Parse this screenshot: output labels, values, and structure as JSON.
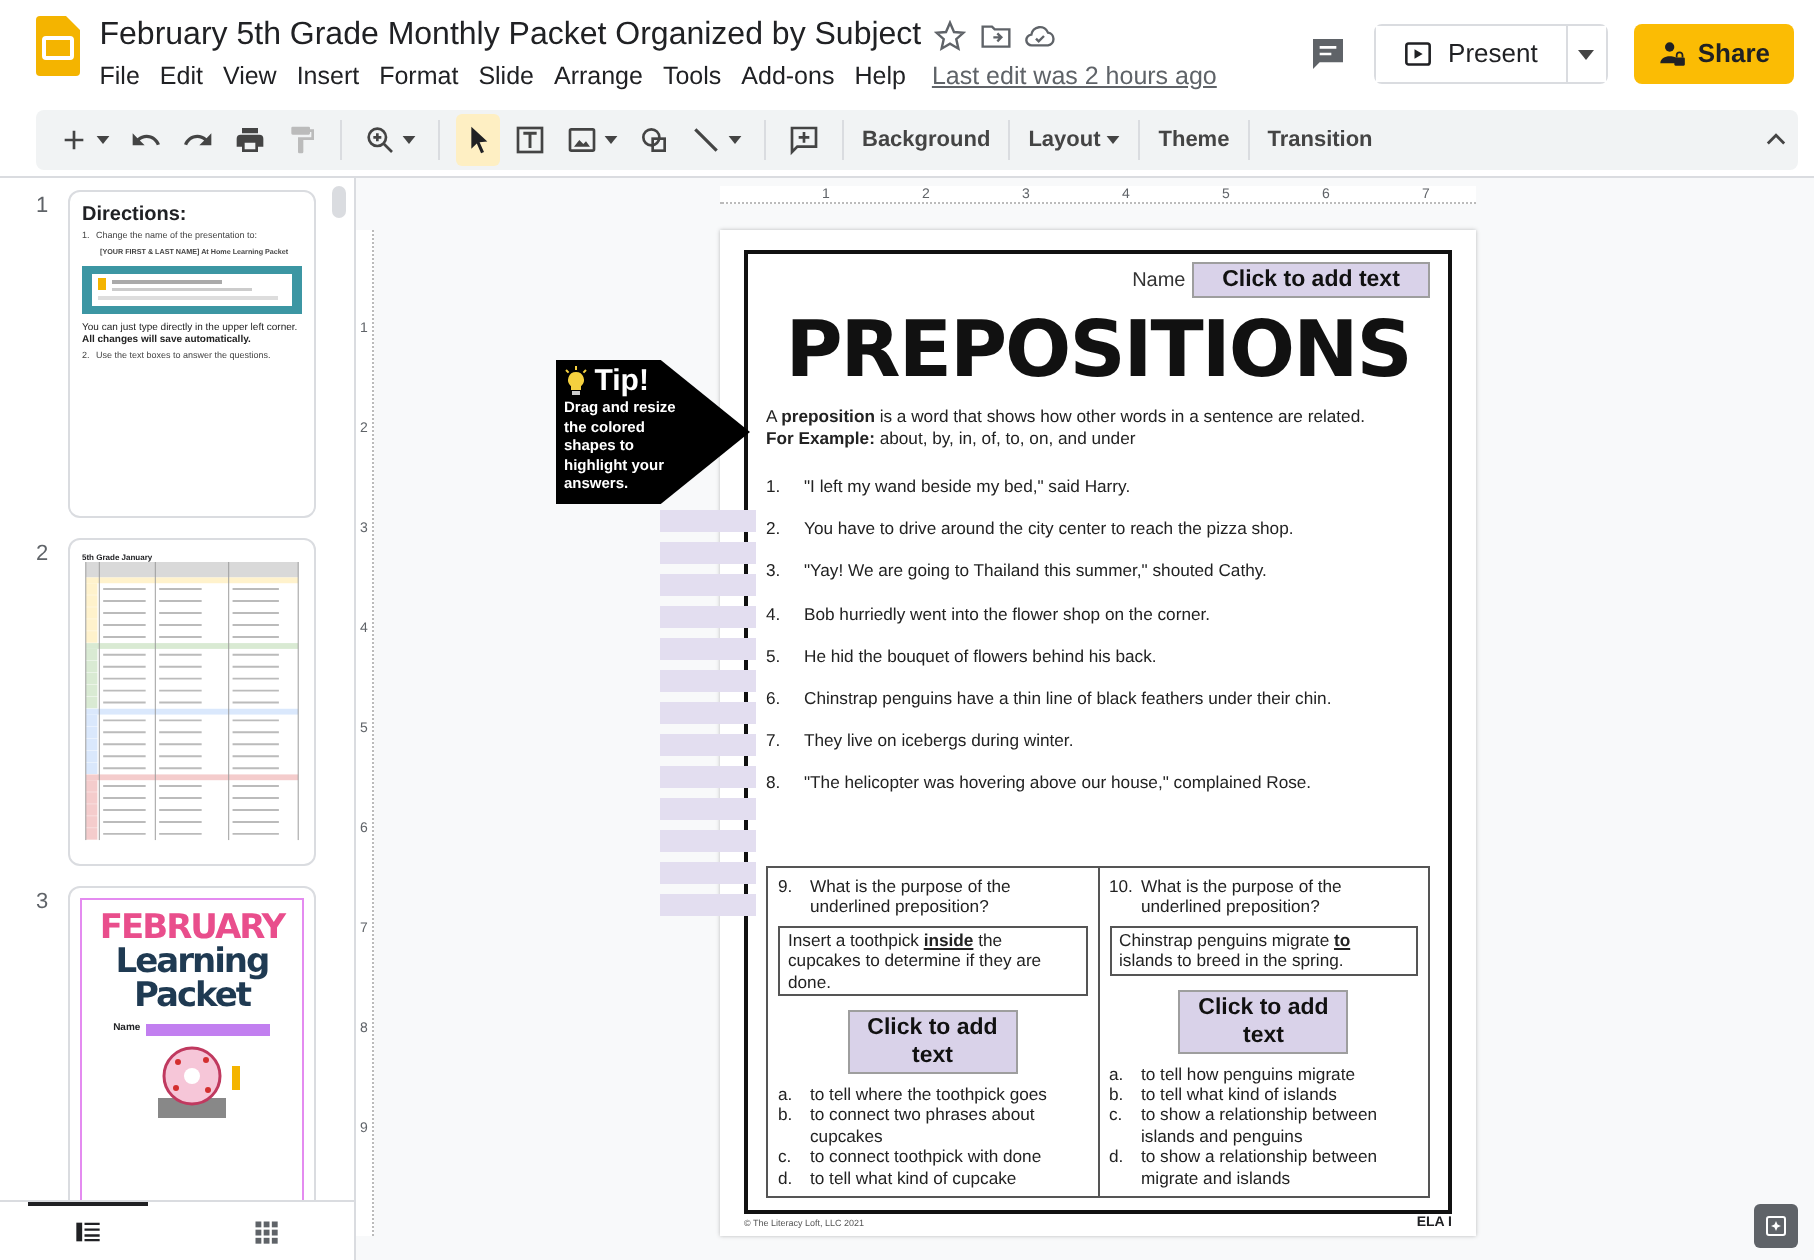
{
  "document": {
    "title": "February 5th Grade Monthly Packet Organized by Subject",
    "starred": false,
    "last_edit": "Last edit was 2 hours ago"
  },
  "menu": [
    "File",
    "Edit",
    "View",
    "Insert",
    "Format",
    "Slide",
    "Arrange",
    "Tools",
    "Add-ons",
    "Help"
  ],
  "actions": {
    "present": "Present",
    "share": "Share"
  },
  "toolbar": [
    [
      {
        "kind": "new",
        "caret": true,
        "selected": false
      },
      {
        "kind": "undo",
        "caret": false,
        "selected": false
      },
      {
        "kind": "redo",
        "caret": false,
        "selected": false
      },
      {
        "kind": "print",
        "caret": false,
        "selected": false
      },
      {
        "kind": "paint",
        "caret": false,
        "selected": false
      }
    ],
    [
      {
        "kind": "zoom",
        "caret": true,
        "selected": false
      }
    ],
    [
      {
        "kind": "select",
        "caret": false,
        "selected": true
      },
      {
        "kind": "textbox",
        "caret": false,
        "selected": false
      },
      {
        "kind": "image",
        "caret": true,
        "selected": false
      },
      {
        "kind": "shape",
        "caret": false,
        "selected": false
      },
      {
        "kind": "line",
        "caret": true,
        "selected": false
      }
    ],
    [
      {
        "kind": "comment",
        "caret": false,
        "selected": false
      }
    ],
    [
      {
        "kind": "label",
        "label": "Background",
        "caret": false,
        "selected": false
      }
    ],
    [
      {
        "kind": "label",
        "label": "Layout",
        "caret": true,
        "selected": false
      }
    ],
    [
      {
        "kind": "label",
        "label": "Theme",
        "caret": false,
        "selected": false
      }
    ],
    [
      {
        "kind": "label",
        "label": "Transition",
        "caret": false,
        "selected": false
      }
    ]
  ],
  "slides": [
    {
      "number": "1",
      "kind": "directions",
      "heading": "Directions:",
      "blocks": [
        {
          "kind": "step",
          "number": "1.",
          "text": "Change the name of the presentation to:"
        },
        {
          "kind": "note",
          "text": "[YOUR FIRST & LAST NAME] At Home Learning Packet"
        },
        {
          "kind": "picture"
        },
        {
          "kind": "para",
          "text": "You can just type directly in the upper left corner. **All changes will save automatically.**"
        },
        {
          "kind": "step",
          "number": "2.",
          "text": "Use the text boxes to answer the questions."
        }
      ]
    },
    {
      "number": "2",
      "kind": "table",
      "heading": "5th Grade January"
    },
    {
      "number": "3",
      "kind": "cover",
      "lines": [
        "FEBRUARY",
        "Learning",
        "Packet"
      ],
      "name_label": "Name"
    }
  ],
  "panel_views": [
    {
      "kind": "list",
      "selected": true
    },
    {
      "kind": "grid",
      "selected": false
    }
  ],
  "rulers": {
    "horizontal": [
      "1",
      "2",
      "3",
      "4",
      "5",
      "6",
      "7"
    ],
    "vertical": [
      "1",
      "2",
      "3",
      "4",
      "5",
      "6",
      "7",
      "8",
      "9"
    ]
  },
  "tip": {
    "title": "Tip!",
    "text": "Drag and resize the colored shapes to highlight your answers."
  },
  "worksheet": {
    "name_label": "Name",
    "name_box": "Click to add text",
    "title": "PREPOSITIONS",
    "definition": [
      "A **preposition** is a word that shows how other words in a sentence are related.",
      "**For Example:** about, by, in, of, to, on, and under"
    ],
    "sentences": [
      {
        "number": "1.",
        "text": "\"I left my wand beside my bed,\" said Harry."
      },
      {
        "number": "2.",
        "text": "You have to drive around the city center to reach the pizza shop."
      },
      {
        "number": "3.",
        "text": "\"Yay! We are going to Thailand this summer,\" shouted Cathy."
      },
      {
        "number": "4.",
        "text": "Bob hurriedly went into the flower shop on the corner."
      },
      {
        "number": "5.",
        "text": "He hid the bouquet of flowers behind his back."
      },
      {
        "number": "6.",
        "text": "Chinstrap penguins have a thin line of black feathers under their chin."
      },
      {
        "number": "7.",
        "text": "They live on icebergs during winter."
      },
      {
        "number": "8.",
        "text": "\"The helicopter was hovering above our house,\" complained Rose."
      }
    ],
    "questions": [
      {
        "number": "9.",
        "prompt": "What is the purpose of the underlined preposition?",
        "sentence": "Insert a toothpick **inside** the cupcakes to determine if they are done.",
        "answer_box": "Click to add text",
        "options": [
          {
            "letter": "a.",
            "text": "to tell where the toothpick goes"
          },
          {
            "letter": "b.",
            "text": "to connect two phrases about cupcakes"
          },
          {
            "letter": "c.",
            "text": "to connect toothpick with done"
          },
          {
            "letter": "d.",
            "text": "to tell what kind of cupcake"
          }
        ]
      },
      {
        "number": "10.",
        "prompt": "What is the purpose of the underlined preposition?",
        "sentence": "Chinstrap penguins migrate **to** islands to breed in the spring.",
        "answer_box": "Click to add text",
        "options": [
          {
            "letter": "a.",
            "text": "to tell how penguins migrate"
          },
          {
            "letter": "b.",
            "text": "to tell what kind of islands"
          },
          {
            "letter": "c.",
            "text": "to show a relationship between islands and penguins"
          },
          {
            "letter": "d.",
            "text": "to show a relationship between migrate and islands"
          }
        ]
      }
    ],
    "footer": "© The Literacy Loft, LLC 2021",
    "code": "ELA I"
  }
}
